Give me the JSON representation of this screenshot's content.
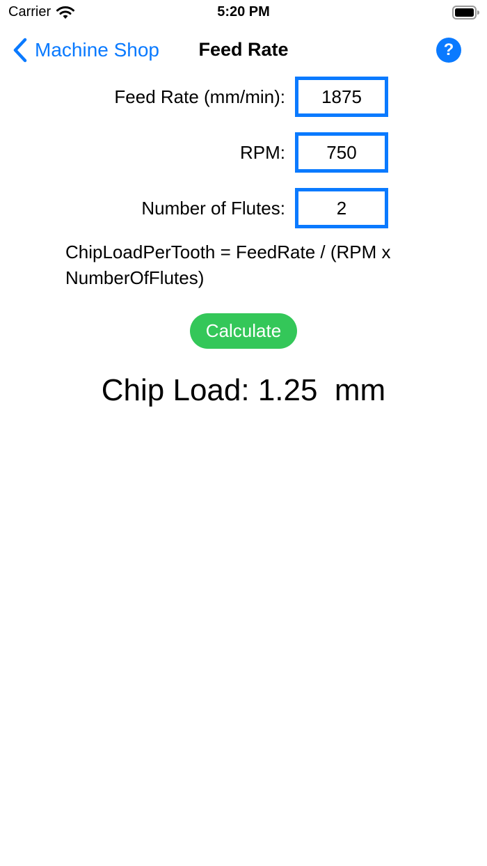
{
  "status_bar": {
    "carrier": "Carrier",
    "time": "5:20 PM",
    "icons": [
      "wifi-icon",
      "battery-icon"
    ]
  },
  "nav": {
    "back_label": "Machine Shop",
    "title": "Feed Rate",
    "help_label": "?",
    "accent_color": "#0a7aff"
  },
  "form": {
    "feed_rate_label": "Feed Rate (mm/min):",
    "feed_rate_value": "1875",
    "rpm_label": "RPM:",
    "rpm_value": "750",
    "flutes_label": "Number of Flutes:",
    "flutes_value": "2"
  },
  "formula": "ChipLoadPerTooth = FeedRate / (RPM x NumberOfFlutes)",
  "calculate": {
    "label": "Calculate",
    "color": "#34c759"
  },
  "result": "Chip Load: 1.25  mm"
}
